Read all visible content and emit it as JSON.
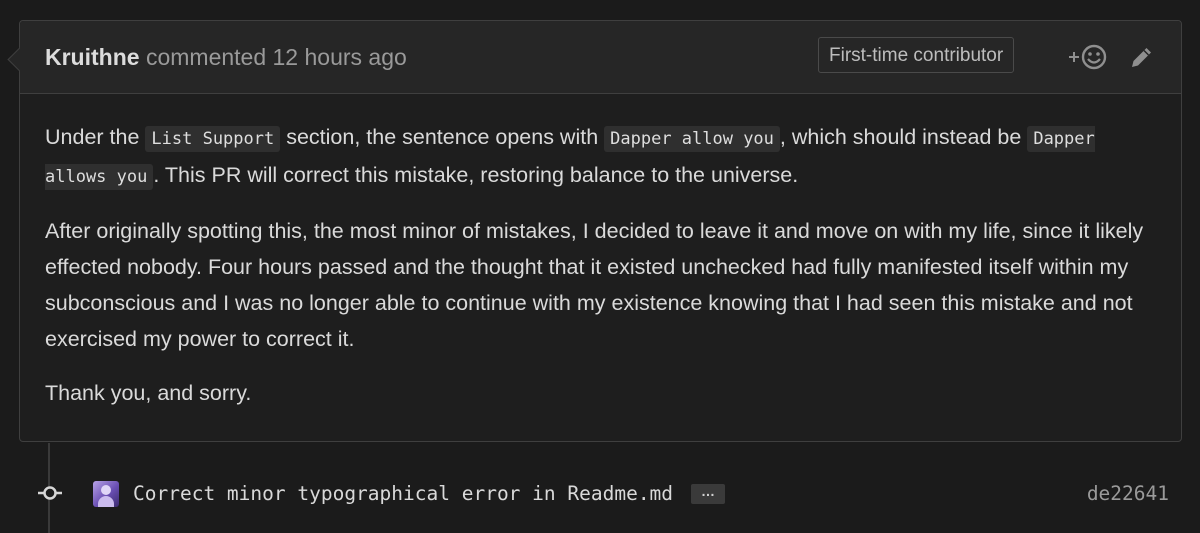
{
  "comment": {
    "author": "Kruithne",
    "action": "commented",
    "time": "12 hours ago",
    "badge": "First-time contributor",
    "paragraphs": {
      "p1": {
        "t1": "Under the ",
        "code1": "List Support",
        "t2": " section, the sentence opens with ",
        "code2": "Dapper allow you",
        "t3": ", which should instead be ",
        "code3": "Dapper allows you",
        "t4": ". This PR will correct this mistake, restoring balance to the universe."
      },
      "p2": "After originally spotting this, the most minor of mistakes, I decided to leave it and move on with my life, since it likely effected nobody. Four hours passed and the thought that it existed unchecked had fully manifested itself within my subconscious and I was no longer able to continue with my existence knowing that I had seen this mistake and not exercised my power to correct it.",
      "p3": "Thank you, and sorry."
    }
  },
  "commit": {
    "message": "Correct minor typographical error in Readme.md",
    "ellipsis": "…",
    "sha": "de22641"
  },
  "icons": {
    "reaction": "add-reaction-smiley-icon",
    "edit": "pencil-icon",
    "commit": "git-commit-icon"
  },
  "colors": {
    "background": "#1b1b1b",
    "header": "#262626",
    "border": "#3f3f3f",
    "text": "#dadada",
    "muted": "#9a9a9a"
  }
}
